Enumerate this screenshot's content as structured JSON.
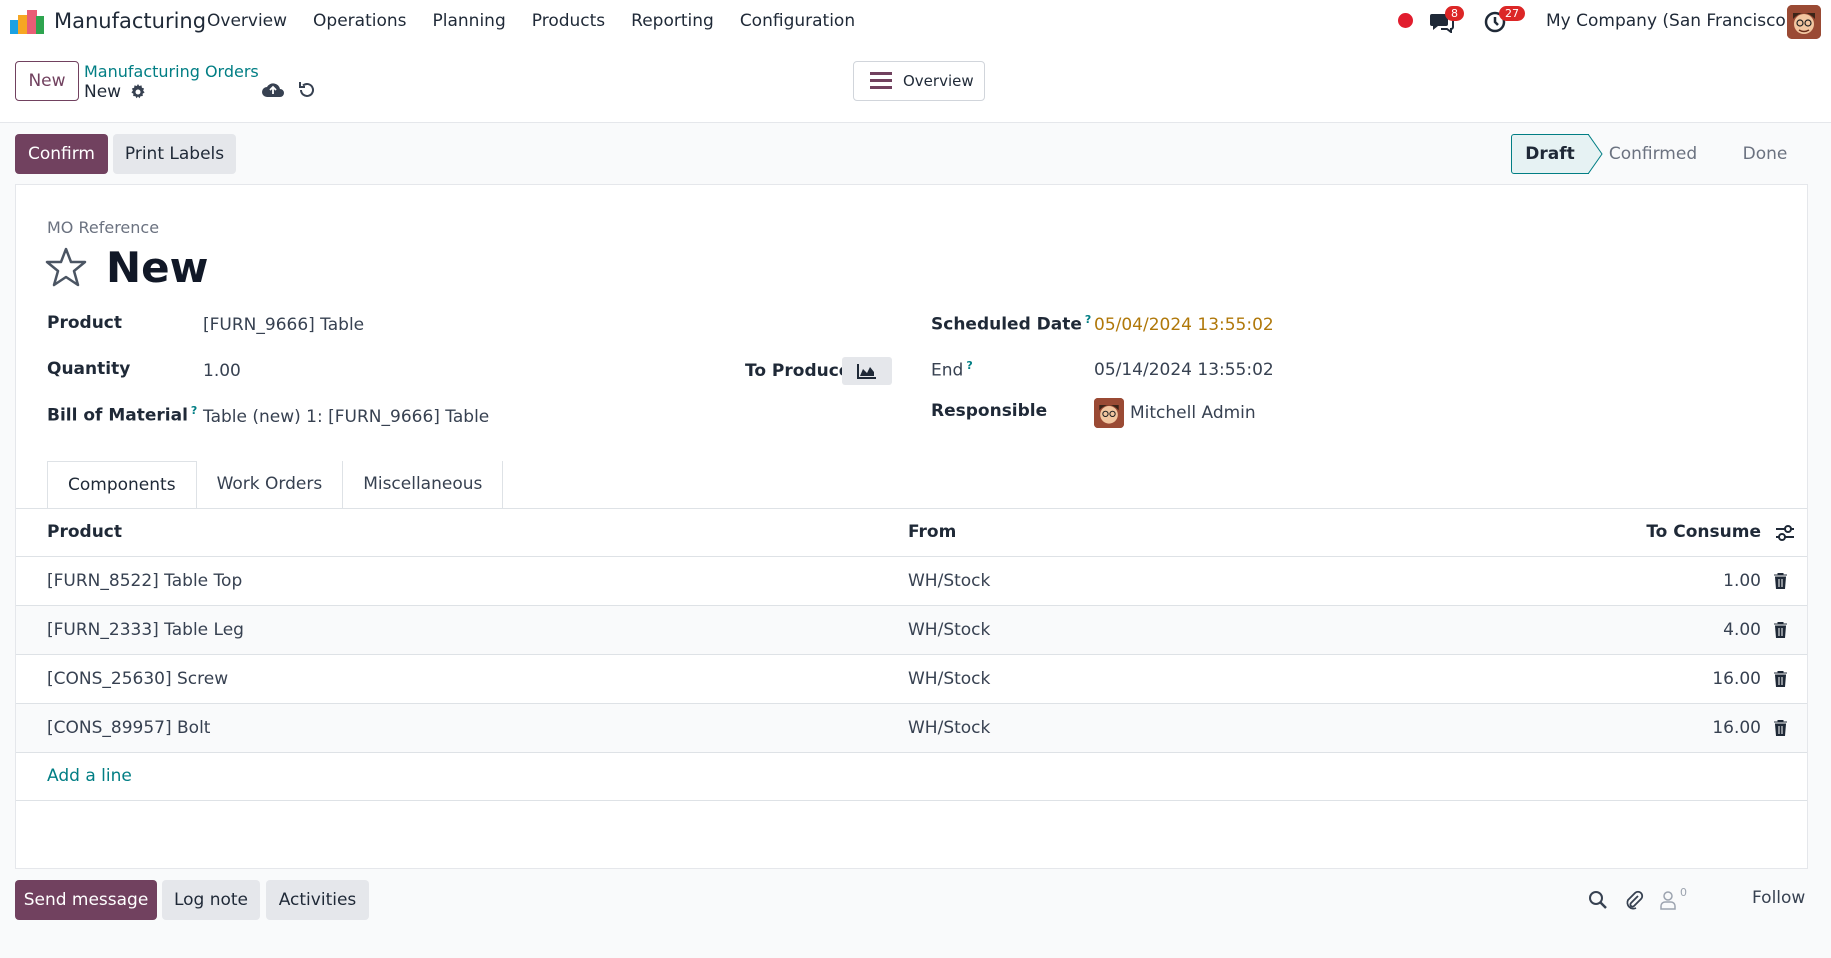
{
  "navbar": {
    "app_name": "Manufacturing",
    "menu": [
      "Overview",
      "Operations",
      "Planning",
      "Products",
      "Reporting",
      "Configuration"
    ],
    "chat_count": "8",
    "activity_count": "27",
    "company": "My Company (San Francisco)"
  },
  "control": {
    "new_label": "New",
    "breadcrumb_parent": "Manufacturing Orders",
    "breadcrumb_current": "New",
    "overview_label": "Overview"
  },
  "actions": {
    "confirm": "Confirm",
    "print_labels": "Print Labels"
  },
  "status": {
    "steps": [
      "Draft",
      "Confirmed",
      "Done"
    ],
    "current": "Draft"
  },
  "form": {
    "mo_reference_label": "MO Reference",
    "title": "New",
    "product_label": "Product",
    "product_value": "[FURN_9666] Table",
    "quantity_label": "Quantity",
    "quantity_value": "1.00",
    "to_produce_label": "To Produce",
    "bom_label": "Bill of Material",
    "bom_value": "Table (new) 1: [FURN_9666] Table",
    "scheduled_label": "Scheduled Date",
    "scheduled_value": "05/04/2024 13:55:02",
    "end_label": "End",
    "end_value": "05/14/2024 13:55:02",
    "responsible_label": "Responsible",
    "responsible_value": "Mitchell Admin",
    "help_mark": "?"
  },
  "tabs": [
    "Components",
    "Work Orders",
    "Miscellaneous"
  ],
  "components": {
    "headers": {
      "product": "Product",
      "from": "From",
      "to_consume": "To Consume"
    },
    "rows": [
      {
        "product": "[FURN_8522] Table Top",
        "from": "WH/Stock",
        "qty": "1.00"
      },
      {
        "product": "[FURN_2333] Table Leg",
        "from": "WH/Stock",
        "qty": "4.00"
      },
      {
        "product": "[CONS_25630] Screw",
        "from": "WH/Stock",
        "qty": "16.00"
      },
      {
        "product": "[CONS_89957] Bolt",
        "from": "WH/Stock",
        "qty": "16.00"
      }
    ],
    "add_line": "Add a line"
  },
  "chatter": {
    "send_message": "Send message",
    "log_note": "Log note",
    "activities": "Activities",
    "follower_count": "0",
    "follow": "Follow"
  },
  "colors": {
    "brand": "#71415f",
    "link": "#017e84",
    "scheduled_date": "#b0780a",
    "badge": "#dc2626"
  }
}
